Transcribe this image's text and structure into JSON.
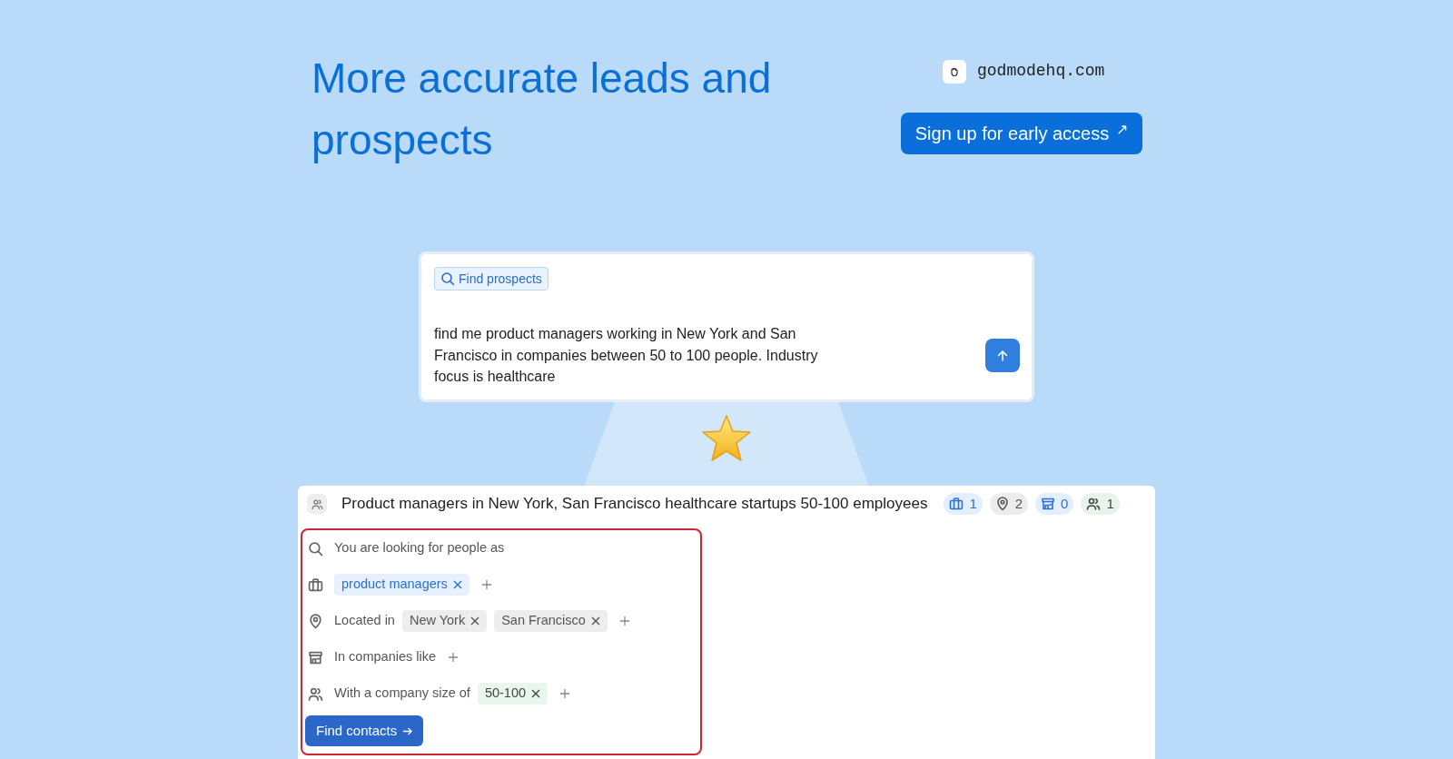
{
  "headline": "More accurate leads and prospects",
  "site": {
    "domain": "godmodehq.com"
  },
  "cta": {
    "label": "Sign up for early access",
    "icon": "↗"
  },
  "prompt": {
    "badge": "Find prospects",
    "text": "find me product managers working in New York and San Francisco in companies between 50 to 100 people. Industry focus is healthcare"
  },
  "result": {
    "title": "Product managers in New York, San Francisco healthcare startups 50-100 employees",
    "counts": [
      {
        "kind": "role",
        "value": "1"
      },
      {
        "kind": "place",
        "value": "2"
      },
      {
        "kind": "company",
        "value": "0"
      },
      {
        "kind": "size",
        "value": "1"
      }
    ],
    "filters": [
      {
        "kind": "search",
        "label": "You are looking for people as",
        "add": false
      },
      {
        "kind": "role",
        "add": true,
        "chips": [
          {
            "kind": "role",
            "label": "product managers"
          }
        ]
      },
      {
        "kind": "place",
        "label": "Located in",
        "add": true,
        "chips": [
          {
            "kind": "place",
            "label": "New York"
          },
          {
            "kind": "place",
            "label": "San Francisco"
          }
        ]
      },
      {
        "kind": "company",
        "label": "In companies like",
        "add": true
      },
      {
        "kind": "size",
        "label": "With a company size of",
        "add": true,
        "chips": [
          {
            "kind": "size",
            "label": "50-100"
          }
        ]
      }
    ],
    "button": "Find contacts"
  }
}
